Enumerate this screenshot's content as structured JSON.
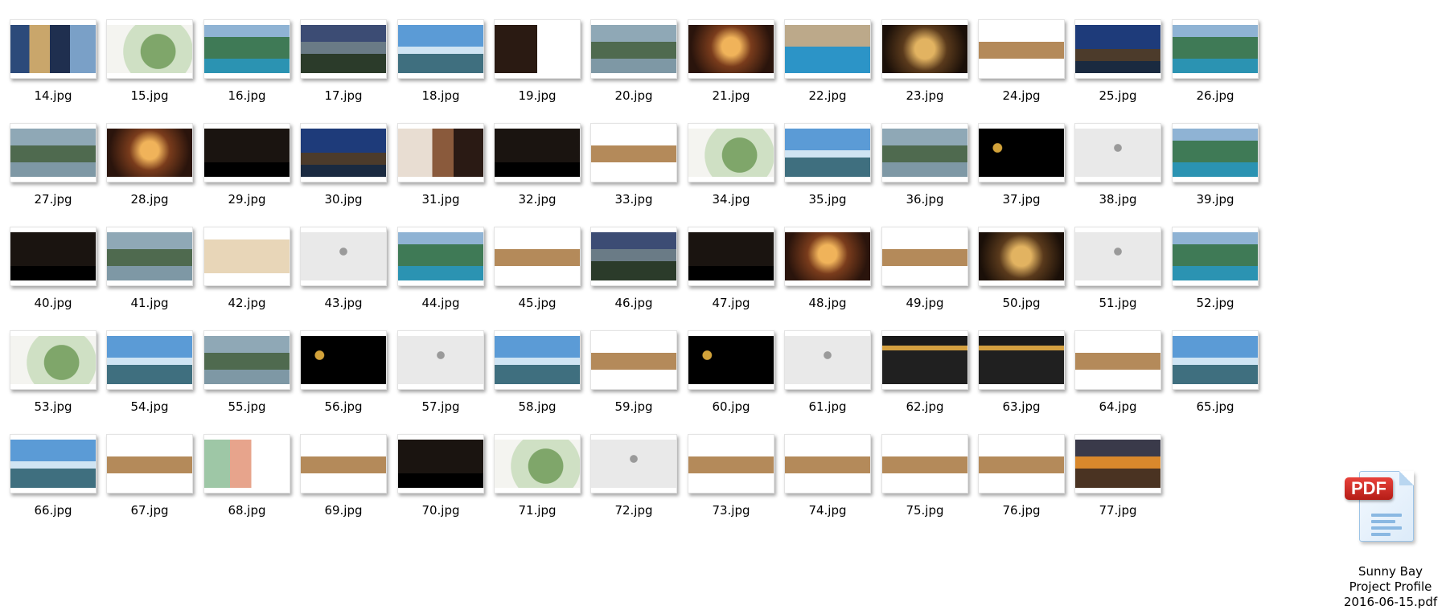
{
  "files": [
    {
      "name": "14.jpg",
      "style": "collage-light"
    },
    {
      "name": "15.jpg",
      "style": "map-light"
    },
    {
      "name": "16.jpg",
      "style": "aerial"
    },
    {
      "name": "17.jpg",
      "style": "dusk"
    },
    {
      "name": "18.jpg",
      "style": "sky"
    },
    {
      "name": "19.jpg",
      "style": "doc-dark-left"
    },
    {
      "name": "20.jpg",
      "style": "lake"
    },
    {
      "name": "21.jpg",
      "style": "warm-interior"
    },
    {
      "name": "22.jpg",
      "style": "pool"
    },
    {
      "name": "23.jpg",
      "style": "gold-interior"
    },
    {
      "name": "24.jpg",
      "style": "doc-photos"
    },
    {
      "name": "25.jpg",
      "style": "night-sky"
    },
    {
      "name": "26.jpg",
      "style": "aerial"
    },
    {
      "name": "27.jpg",
      "style": "lake"
    },
    {
      "name": "28.jpg",
      "style": "warm-interior"
    },
    {
      "name": "29.jpg",
      "style": "dark-text"
    },
    {
      "name": "30.jpg",
      "style": "night-sky"
    },
    {
      "name": "31.jpg",
      "style": "spa"
    },
    {
      "name": "32.jpg",
      "style": "dark-text"
    },
    {
      "name": "33.jpg",
      "style": "doc-photos"
    },
    {
      "name": "34.jpg",
      "style": "map-light"
    },
    {
      "name": "35.jpg",
      "style": "sky"
    },
    {
      "name": "36.jpg",
      "style": "lake"
    },
    {
      "name": "37.jpg",
      "style": "black-logo"
    },
    {
      "name": "38.jpg",
      "style": "grey-logo"
    },
    {
      "name": "39.jpg",
      "style": "aerial"
    },
    {
      "name": "40.jpg",
      "style": "dark-text"
    },
    {
      "name": "41.jpg",
      "style": "lake"
    },
    {
      "name": "42.jpg",
      "style": "doc-beige"
    },
    {
      "name": "43.jpg",
      "style": "grey-logo"
    },
    {
      "name": "44.jpg",
      "style": "aerial"
    },
    {
      "name": "45.jpg",
      "style": "doc-photos"
    },
    {
      "name": "46.jpg",
      "style": "dusk"
    },
    {
      "name": "47.jpg",
      "style": "dark-text"
    },
    {
      "name": "48.jpg",
      "style": "warm-interior"
    },
    {
      "name": "49.jpg",
      "style": "doc-photos"
    },
    {
      "name": "50.jpg",
      "style": "gold-interior"
    },
    {
      "name": "51.jpg",
      "style": "grey-logo"
    },
    {
      "name": "52.jpg",
      "style": "aerial"
    },
    {
      "name": "53.jpg",
      "style": "map-light"
    },
    {
      "name": "54.jpg",
      "style": "sky"
    },
    {
      "name": "55.jpg",
      "style": "lake"
    },
    {
      "name": "56.jpg",
      "style": "black-logo"
    },
    {
      "name": "57.jpg",
      "style": "grey-logo"
    },
    {
      "name": "58.jpg",
      "style": "sky"
    },
    {
      "name": "59.jpg",
      "style": "doc-photos"
    },
    {
      "name": "60.jpg",
      "style": "black-logo"
    },
    {
      "name": "61.jpg",
      "style": "grey-logo"
    },
    {
      "name": "62.jpg",
      "style": "dark-chart"
    },
    {
      "name": "63.jpg",
      "style": "dark-chart"
    },
    {
      "name": "64.jpg",
      "style": "doc-photos"
    },
    {
      "name": "65.jpg",
      "style": "sky"
    },
    {
      "name": "66.jpg",
      "style": "sky"
    },
    {
      "name": "67.jpg",
      "style": "doc-photos"
    },
    {
      "name": "68.jpg",
      "style": "map-color"
    },
    {
      "name": "69.jpg",
      "style": "doc-photos"
    },
    {
      "name": "70.jpg",
      "style": "dark-text"
    },
    {
      "name": "71.jpg",
      "style": "map-light"
    },
    {
      "name": "72.jpg",
      "style": "grey-logo"
    },
    {
      "name": "73.jpg",
      "style": "doc-photos"
    },
    {
      "name": "74.jpg",
      "style": "doc-photos"
    },
    {
      "name": "75.jpg",
      "style": "doc-photos"
    },
    {
      "name": "76.jpg",
      "style": "doc-photos"
    },
    {
      "name": "77.jpg",
      "style": "sunset"
    }
  ],
  "pdf": {
    "badge": "PDF",
    "name_line1": "Sunny Bay",
    "name_line2": "Project Profile",
    "name_line3": "2016-06-15.pdf",
    "icon": "pdf-file-icon"
  }
}
